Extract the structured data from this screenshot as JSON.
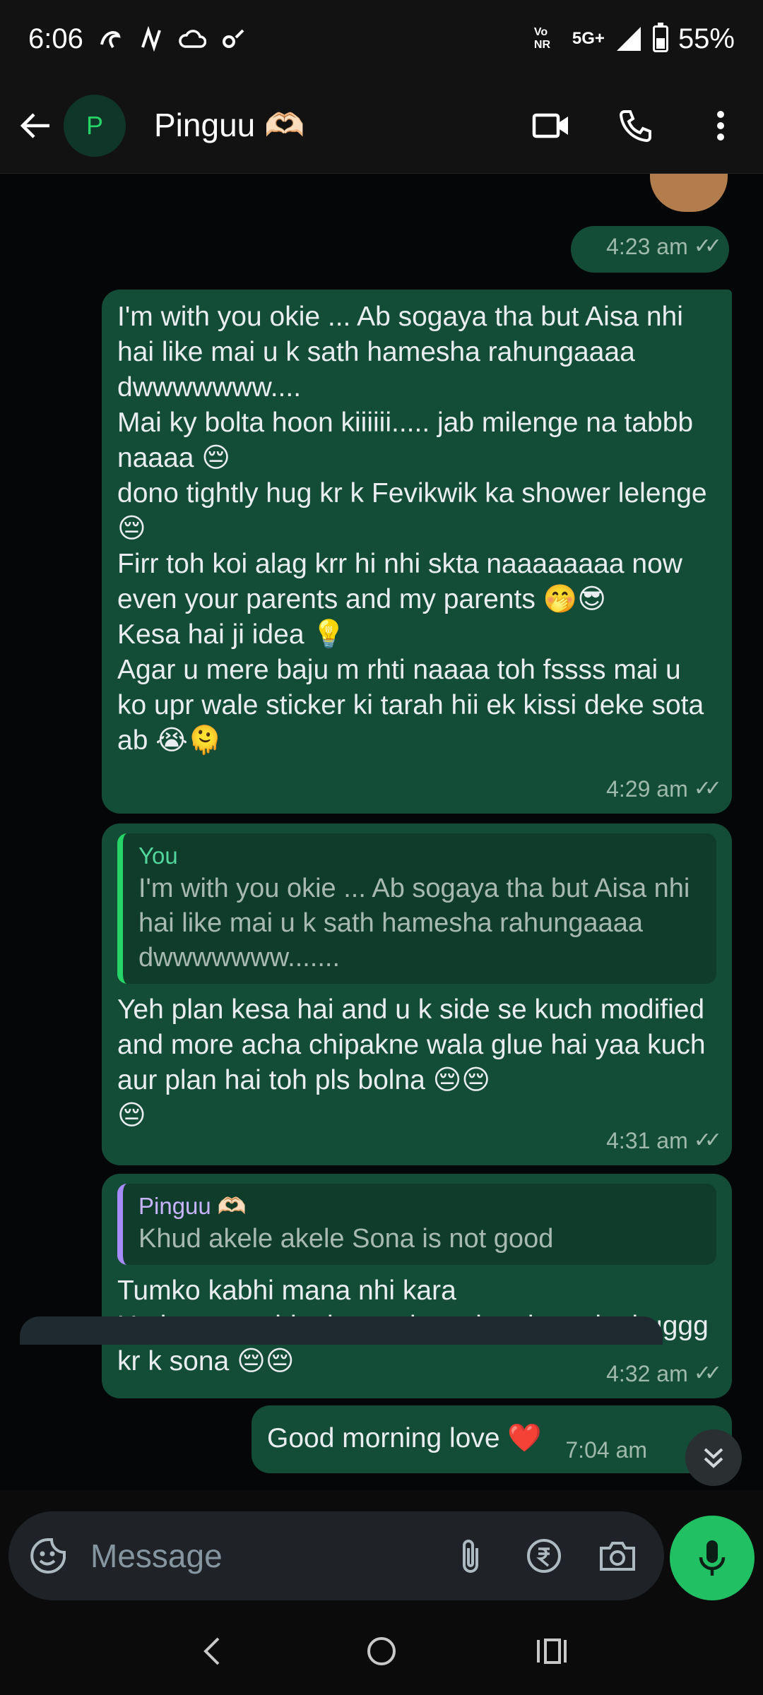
{
  "status_bar": {
    "time": "6:06",
    "network_label": "5G+",
    "volte_label": "Vo NR",
    "battery": "55%",
    "battery_level": 0.55
  },
  "header": {
    "avatar_letter": "P",
    "contact_name": "Pinguu 🫶🏻"
  },
  "messages": [
    {
      "time": "4:23 am",
      "text": ""
    },
    {
      "text": "I'm with you okie ... Ab sogaya tha but Aisa nhi hai like mai u k sath hamesha rahungaaaa dwwwwwww....\nMai ky bolta hoon kiiiiii..... jab milenge na tabbb naaaa 😔\ndono tightly hug kr k Fevikwik ka shower lelenge😔\nFirr toh koi alag krr hi nhi skta naaaaaaaa now even your parents and my parents 🤭😎\nKesa hai ji idea 💡\nAgar u mere baju m rhti naaaa toh fssss mai u ko upr wale sticker ki tarah hii ek kissi deke sota ab 😭🫠",
      "time": "4:29 am"
    },
    {
      "quote_author": "You",
      "quote_text": "I'm with you okie ... Ab sogaya tha but Aisa nhi hai like mai u k sath hamesha rahungaaaa dwwwwwww.......",
      "text": "Yeh plan kesa hai and u k side se kuch modified and more acha chipakne wala glue hai yaa kuch aur plan hai toh pls bolna 😔😔\n😔",
      "time": "4:31 am"
    },
    {
      "quote_author": "Pinguu 🫶🏻",
      "quote_text": "Khud akele akele Sona is not good",
      "text": "Tumko kabhi mana nhi kara\nU ajao mere blanket mai anytime bas ake huggg kr k sona 😔😔",
      "time": "4:32 am"
    },
    {
      "text": "Good morning love ❤️",
      "time": "7:04 am"
    }
  ],
  "input": {
    "placeholder": "Message"
  },
  "colors": {
    "outgoing_bubble": "#144d37",
    "accent_green": "#21c063",
    "header_bg": "#121212"
  }
}
